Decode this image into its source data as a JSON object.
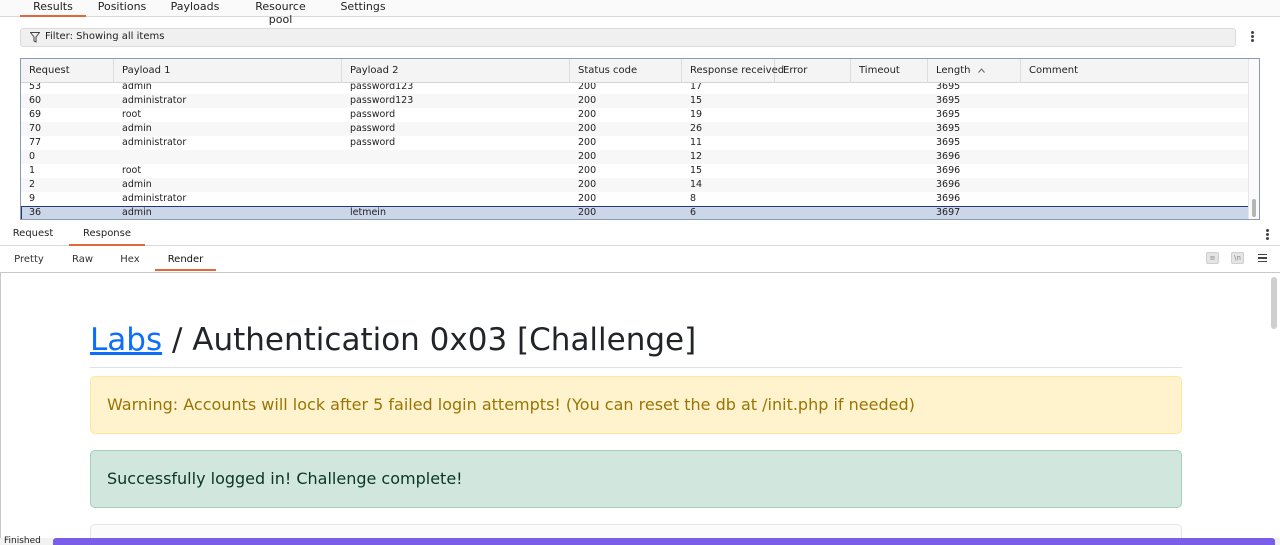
{
  "top_tabs": [
    "Results",
    "Positions",
    "Payloads",
    "Resource pool",
    "Settings"
  ],
  "filter": {
    "label": "Filter: Showing all items"
  },
  "table": {
    "columns": [
      "Request",
      "Payload 1",
      "Payload 2",
      "Status code",
      "Response received",
      "Error",
      "Timeout",
      "Length",
      "Comment"
    ],
    "sort_column": "Length",
    "rows": [
      [
        "53",
        "admin",
        "password123",
        "200",
        "17",
        "",
        "",
        "3695",
        ""
      ],
      [
        "60",
        "administrator",
        "password123",
        "200",
        "15",
        "",
        "",
        "3695",
        ""
      ],
      [
        "69",
        "root",
        "password",
        "200",
        "19",
        "",
        "",
        "3695",
        ""
      ],
      [
        "70",
        "admin",
        "password",
        "200",
        "26",
        "",
        "",
        "3695",
        ""
      ],
      [
        "77",
        "administrator",
        "password",
        "200",
        "11",
        "",
        "",
        "3695",
        ""
      ],
      [
        "0",
        "",
        "",
        "200",
        "12",
        "",
        "",
        "3696",
        ""
      ],
      [
        "1",
        "root",
        "",
        "200",
        "15",
        "",
        "",
        "3696",
        ""
      ],
      [
        "2",
        "admin",
        "",
        "200",
        "14",
        "",
        "",
        "3696",
        ""
      ],
      [
        "9",
        "administrator",
        "",
        "200",
        "8",
        "",
        "",
        "3696",
        ""
      ],
      [
        "36",
        "admin",
        "letmein",
        "200",
        "6",
        "",
        "",
        "3697",
        ""
      ]
    ],
    "selected_row": 9
  },
  "rr_tabs": [
    "Request",
    "Response"
  ],
  "view_tabs": [
    "Pretty",
    "Raw",
    "Hex",
    "Render"
  ],
  "toolbar_icons": [
    {
      "name": "wrap-lines-icon",
      "glyph": "≡"
    },
    {
      "name": "newline-icon",
      "glyph": "\\n"
    }
  ],
  "render": {
    "heading_link": "Labs",
    "heading_rest": " / Authentication 0x03 [Challenge]",
    "warning": "Warning: Accounts will lock after 5 failed login attempts! (You can reset the db at /init.php if needed)",
    "success": "Successfully logged in! Challenge complete!"
  },
  "status": {
    "text": "Finished",
    "progress": 1.0
  },
  "colors": {
    "accent": "#e2683c",
    "link": "#0d6efd",
    "warning_bg": "#fff3cd",
    "success_bg": "#d1e7dd",
    "selected_row": "#cbd6e8",
    "progress": "#7a5ee8"
  }
}
